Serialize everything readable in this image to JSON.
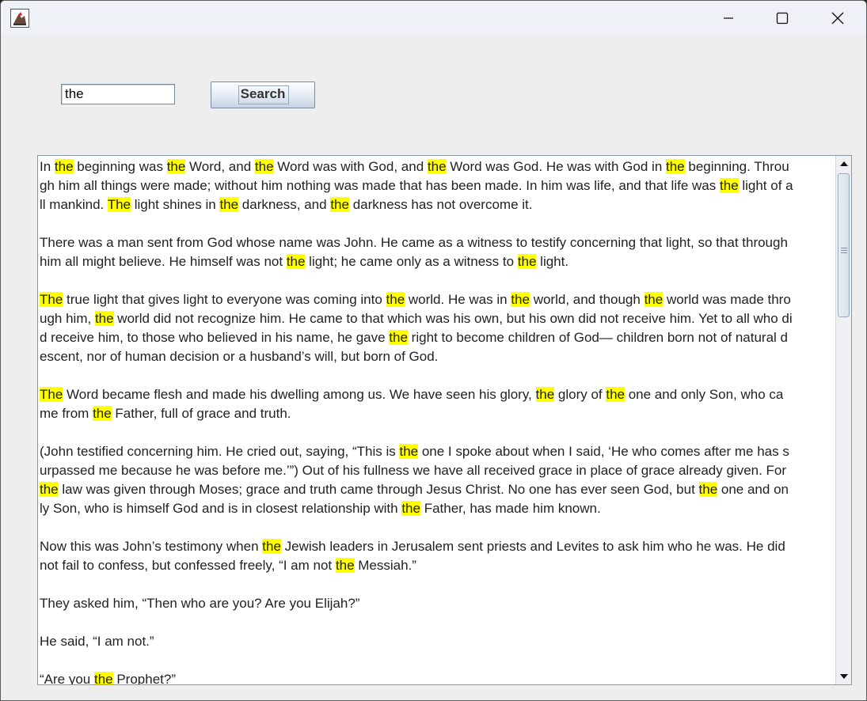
{
  "window": {
    "controls": {
      "minimize_icon": "minimize-icon",
      "maximize_icon": "maximize-icon",
      "close_icon": "close-icon"
    },
    "app_icon": "java-app-icon"
  },
  "search": {
    "value": "the",
    "button_label": "Search"
  },
  "highlight": {
    "term": "the",
    "color": "#ffff00"
  },
  "text_lines": [
    "In the beginning was the Word, and the Word was with God, and the Word was God. He was with God in the beginning. Throu",
    "gh him all things were made; without him nothing was made that has been made. In him was life, and that life was the light of a",
    "ll mankind. The light shines in the darkness, and the darkness has not overcome it.",
    "",
    "There was a man sent from God whose name was John. He came as a witness to testify concerning that light, so that through",
    "him all might believe. He himself was not the light; he came only as a witness to the light.",
    "",
    "The true light that gives light to everyone was coming into the world. He was in the world, and though the world was made thro",
    "ugh him, the world did not recognize him. He came to that which was his own, but his own did not receive him. Yet to all who di",
    "d receive him, to those who believed in his name, he gave the right to become children of God— children born not of natural d",
    "escent, nor of human decision or a husband’s will, but born of God.",
    "",
    "The Word became flesh and made his dwelling among us. We have seen his glory, the glory of the one and only Son, who ca",
    "me from the Father, full of grace and truth.",
    "",
    "(John testified concerning him. He cried out, saying, “This is the one I spoke about when I said, ‘He who comes after me has s",
    "urpassed me because he was before me.’”) Out of his fullness we have all received grace in place of grace already given. For",
    "the law was given through Moses; grace and truth came through Jesus Christ. No one has ever seen God, but the one and on",
    "ly Son, who is himself God and is in closest relationship with the Father, has made him known.",
    "",
    "Now this was John’s testimony when the Jewish leaders in Jerusalem sent priests and Levites to ask him who he was. He did",
    "not fail to confess, but confessed freely, “I am not the Messiah.”",
    "",
    "They asked him, “Then who are you? Are you Elijah?”",
    "",
    "He said, “I am not.”",
    "",
    "“Are you the Prophet?”"
  ],
  "scrollbar": {
    "position_fraction": 0.0,
    "visible_fraction": 0.29
  }
}
